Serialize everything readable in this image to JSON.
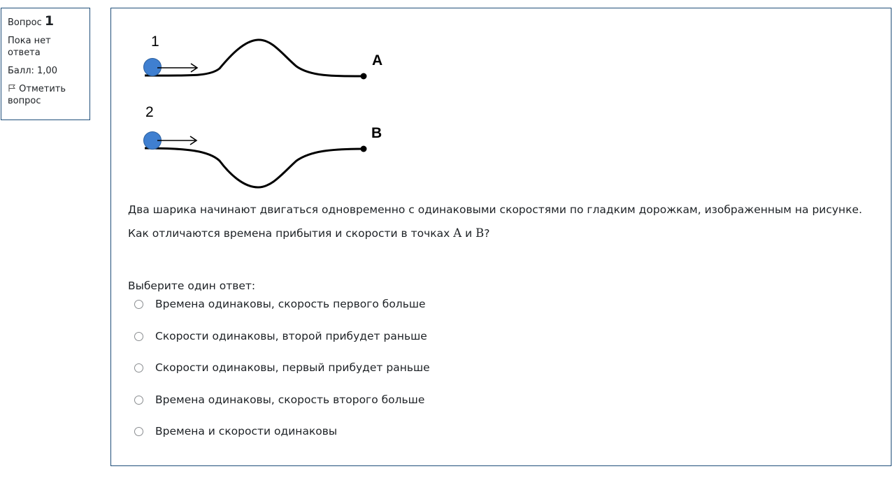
{
  "info": {
    "question_label": "Вопрос",
    "question_number": "1",
    "state": "Пока нет ответа",
    "grade": "Балл: 1,00",
    "flag_label": "Отметить вопрос",
    "flag_icon": "flag-icon"
  },
  "figure": {
    "track1_label": "1",
    "track2_label": "2",
    "point1_label": "A",
    "point2_label": "B",
    "ball_color": "#3f7fd0"
  },
  "question": {
    "text1": "Два шарика начинают двигаться одновременно с одинаковыми скоростями по гладким дорожкам, изображенным на рисунке.",
    "text2_before": "Как отличаются времена прибытия и скорости в точках ",
    "point_a": "A",
    "text2_and": " и ",
    "point_b": "B",
    "text2_after": "?"
  },
  "prompt": "Выберите один ответ:",
  "answers": [
    "Времена одинаковы, скорость первого больше",
    "Скорости одинаковы, второй прибудет раньше",
    "Скорости одинаковы, первый прибудет раньше",
    "Времена одинаковы, скорость второго больше",
    "Времена и скорости одинаковы"
  ]
}
